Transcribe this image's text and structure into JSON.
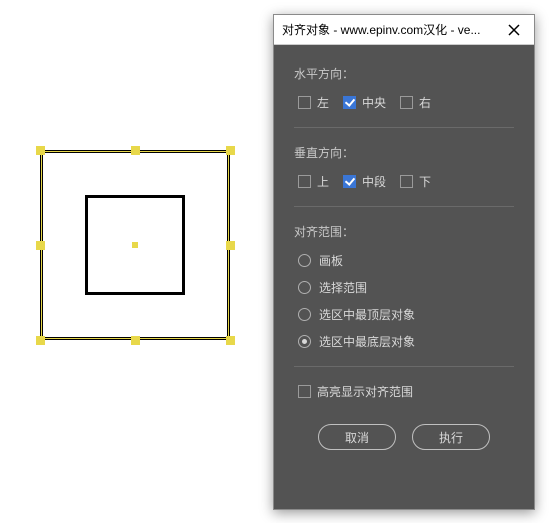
{
  "canvas": {},
  "dialog": {
    "title": "对齐对象 - www.epinv.com汉化 - ve...",
    "horizontal": {
      "label": "水平方向：",
      "options": {
        "left": {
          "label": "左",
          "checked": false
        },
        "center": {
          "label": "中央",
          "checked": true
        },
        "right": {
          "label": "右",
          "checked": false
        }
      }
    },
    "vertical": {
      "label": "垂直方向：",
      "options": {
        "top": {
          "label": "上",
          "checked": false
        },
        "middle": {
          "label": "中段",
          "checked": true
        },
        "bottom": {
          "label": "下",
          "checked": false
        }
      }
    },
    "scope": {
      "label": "对齐范围：",
      "options": [
        {
          "label": "画板",
          "checked": false
        },
        {
          "label": "选择范围",
          "checked": false
        },
        {
          "label": "选区中最顶层对象",
          "checked": false
        },
        {
          "label": "选区中最底层对象",
          "checked": true
        }
      ]
    },
    "highlight": {
      "label": "高亮显示对齐范围",
      "checked": false
    },
    "buttons": {
      "cancel": "取消",
      "ok": "执行"
    }
  }
}
